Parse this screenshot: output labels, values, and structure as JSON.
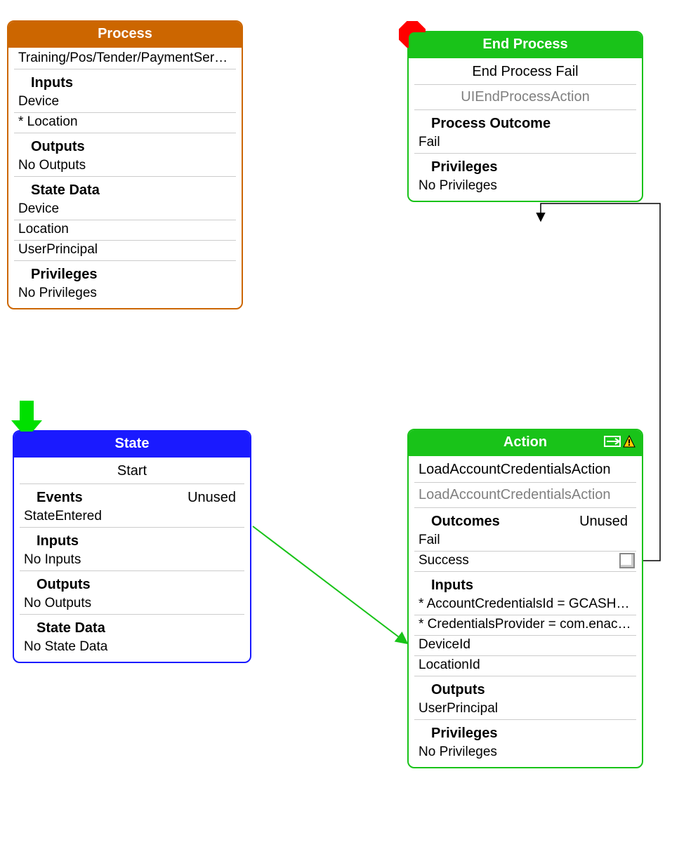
{
  "process": {
    "title": "Process",
    "path": "Training/Pos/Tender/PaymentServ…",
    "inputs_head": "Inputs",
    "inputs": [
      "Device",
      "* Location"
    ],
    "outputs_head": "Outputs",
    "outputs_none": "No Outputs",
    "state_head": "State Data",
    "state_items": [
      "Device",
      "Location",
      "UserPrincipal"
    ],
    "priv_head": "Privileges",
    "priv_none": "No Privileges"
  },
  "endproc": {
    "title": "End Process",
    "name": "End Process Fail",
    "class": "UIEndProcessAction",
    "outcome_head": "Process Outcome",
    "outcome": "Fail",
    "priv_head": "Privileges",
    "priv_none": "No Privileges"
  },
  "state": {
    "title": "State",
    "name": "Start",
    "events_head": "Events",
    "events_right": "Unused",
    "events_item": "StateEntered",
    "inputs_head": "Inputs",
    "inputs_none": "No Inputs",
    "outputs_head": "Outputs",
    "outputs_none": "No Outputs",
    "state_head": "State Data",
    "state_none": "No State Data"
  },
  "action": {
    "title": "Action",
    "name": "LoadAccountCredentialsAction",
    "class": "LoadAccountCredentialsAction",
    "outcomes_head": "Outcomes",
    "outcomes_right": "Unused",
    "outcome_fail": "Fail",
    "outcome_success": "Success",
    "inputs_head": "Inputs",
    "inputs": [
      "* AccountCredentialsId = GCASH…",
      "* CredentialsProvider = com.enac…",
      "DeviceId",
      "LocationId"
    ],
    "outputs_head": "Outputs",
    "outputs_item": "UserPrincipal",
    "priv_head": "Privileges",
    "priv_none": "No Privileges"
  }
}
